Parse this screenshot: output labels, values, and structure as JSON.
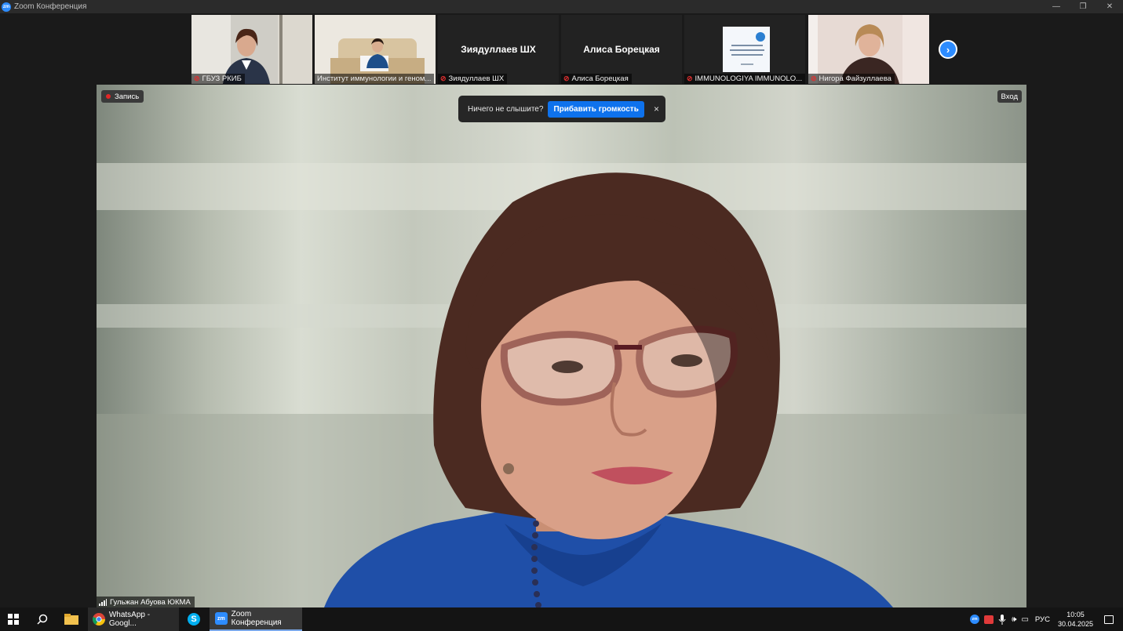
{
  "window": {
    "title": "Zoom Конференция",
    "logo_text": "zm",
    "controls": [
      "—",
      "❐",
      "✕"
    ]
  },
  "gallery": {
    "participants": [
      {
        "name": "ГБУЗ РКИБ",
        "video": true
      },
      {
        "name": "Институт иммунологии и геном...",
        "video": true
      },
      {
        "name": "Зиядуллаев ШХ",
        "center_name": "Зиядуллаев ШХ",
        "video": false
      },
      {
        "name": "Алиса Борецкая",
        "center_name": "Алиса Борецкая",
        "video": false
      },
      {
        "name": "IMMUNOLOGIYA IMMUNOLO...",
        "video": true
      },
      {
        "name": "Нигора Файзуллаева",
        "video": true
      }
    ],
    "next_icon": "›"
  },
  "main": {
    "recording_label": "Запись",
    "login_label": "Вход",
    "audio_prompt": "Ничего не слышите?",
    "volume_button": "Прибавить громкость",
    "close_icon": "×",
    "speaker_name": "Гульжан Абуова ЮКМА"
  },
  "taskbar": {
    "apps": [
      {
        "label": "WhatsApp - Googl...",
        "icon": "chrome-icon"
      },
      {
        "label": "",
        "icon": "skype-icon"
      },
      {
        "label": "Zoom Конференция",
        "icon": "zoom-icon"
      }
    ],
    "language": "РУС",
    "time": "10:05",
    "date": "30.04.2025"
  },
  "colors": {
    "accent": "#2d8cff",
    "button": "#0e72ed",
    "mute_red": "#e02f2f",
    "record_red": "#e32626"
  }
}
